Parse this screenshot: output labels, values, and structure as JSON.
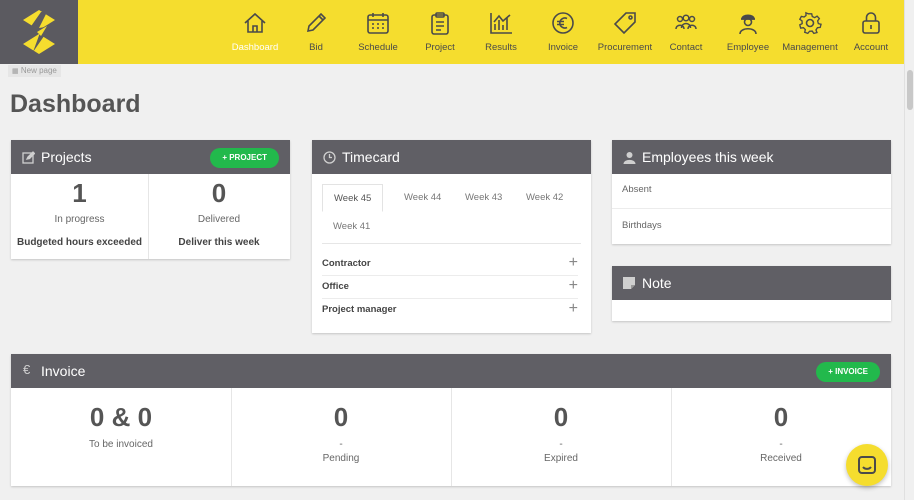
{
  "colors": {
    "brand_yellow": "#f5dd2e",
    "header_gray": "#605f65",
    "green": "#22b94c"
  },
  "nav": [
    {
      "label": "Dashboard",
      "icon": "home-icon",
      "active": true
    },
    {
      "label": "Bid",
      "icon": "pencil-icon"
    },
    {
      "label": "Schedule",
      "icon": "calendar-icon"
    },
    {
      "label": "Project",
      "icon": "clipboard-icon"
    },
    {
      "label": "Results",
      "icon": "bar-chart-icon"
    },
    {
      "label": "Invoice",
      "icon": "euro-icon"
    },
    {
      "label": "Procurement",
      "icon": "tag-icon"
    },
    {
      "label": "Contact",
      "icon": "people-icon"
    },
    {
      "label": "Employee",
      "icon": "worker-icon"
    },
    {
      "label": "Management",
      "icon": "gear-icon"
    },
    {
      "label": "Account",
      "icon": "lock-icon"
    }
  ],
  "tab_badge": "New page",
  "page_title": "Dashboard",
  "projects": {
    "title": "Projects",
    "button": "+ PROJECT",
    "stats": [
      {
        "value": "1",
        "label": "In progress",
        "sub": "Budgeted hours exceeded"
      },
      {
        "value": "0",
        "label": "Delivered",
        "sub": "Deliver this week"
      }
    ]
  },
  "timecard": {
    "title": "Timecard",
    "tabs": [
      "Week 45",
      "Week 44",
      "Week 43",
      "Week 42",
      "Week 41"
    ],
    "active_tab": "Week 45",
    "rows": [
      "Contractor",
      "Office",
      "Project manager"
    ],
    "plus": "+"
  },
  "employees": {
    "title": "Employees this week",
    "rows": [
      "Absent",
      "Birthdays"
    ]
  },
  "note": {
    "title": "Note"
  },
  "invoice": {
    "title": "Invoice",
    "button": "+ INVOICE",
    "stats": [
      {
        "value": "0 & 0",
        "dash": "",
        "label": "To be invoiced"
      },
      {
        "value": "0",
        "dash": "-",
        "label": "Pending"
      },
      {
        "value": "0",
        "dash": "-",
        "label": "Expired"
      },
      {
        "value": "0",
        "dash": "-",
        "label": "Received"
      }
    ]
  }
}
